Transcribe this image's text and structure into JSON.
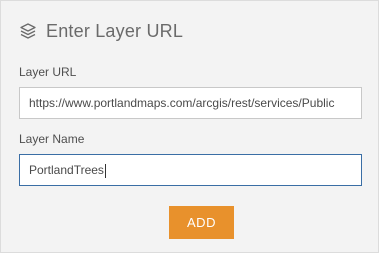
{
  "header": {
    "title": "Enter Layer URL",
    "icon": "layers-icon"
  },
  "form": {
    "url_label": "Layer URL",
    "url_value": "https://www.portlandmaps.com/arcgis/rest/services/Public",
    "name_label": "Layer Name",
    "name_value": "PortlandTrees"
  },
  "actions": {
    "add_label": "ADD"
  },
  "colors": {
    "accent": "#e8912c",
    "focus_border": "#3a6ea5",
    "panel_bg": "#f3f3f3"
  }
}
